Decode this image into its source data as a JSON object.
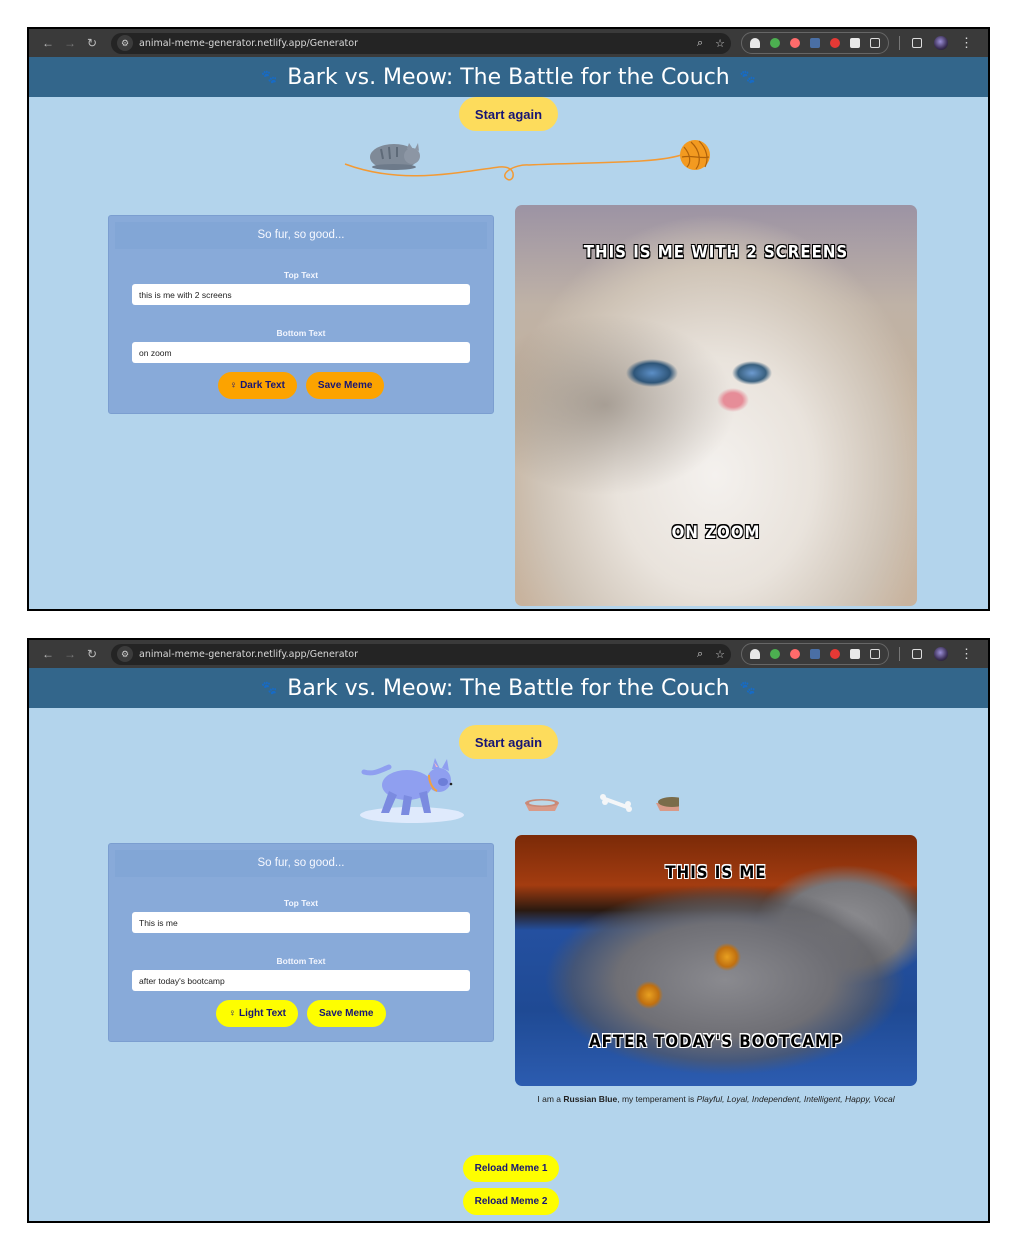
{
  "screens": [
    {
      "browser": {
        "url": "animal-meme-generator.netlify.app/Generator",
        "nav": {
          "back": "←",
          "forward": "→",
          "reload": "↻"
        }
      },
      "header": {
        "title": "Bark vs. Meow: The Battle for the Couch",
        "icon_left": "paw-icon",
        "icon_right": "paw-icon"
      },
      "start_again_label": "Start again",
      "illustration": "sleeping-cat-with-yarn-ball",
      "form": {
        "title": "So fur, so good...",
        "top_label": "Top Text",
        "top_value": "this is me with 2 screens",
        "bottom_label": "Bottom Text",
        "bottom_value": "on zoom",
        "toggle_label": "Dark Text",
        "save_label": "Save Meme",
        "button_color": "#fca300"
      },
      "meme": {
        "top_text": "THIS IS ME WITH 2 SCREENS",
        "bottom_text": "ON ZOOM",
        "text_style": "light",
        "image": "white-fluffy-kitten-looking-up"
      }
    },
    {
      "browser": {
        "url": "animal-meme-generator.netlify.app/Generator",
        "nav": {
          "back": "←",
          "forward": "→",
          "reload": "↻"
        }
      },
      "header": {
        "title": "Bark vs. Meow: The Battle for the Couch",
        "icon_left": "paw-icon",
        "icon_right": "paw-icon"
      },
      "start_again_label": "Start again",
      "illustration": "dog-with-bowls-and-bone",
      "form": {
        "title": "So fur, so good...",
        "top_label": "Top Text",
        "top_value": "This is me",
        "bottom_label": "Bottom Text",
        "bottom_value": "after today's bootcamp",
        "toggle_label": "Light Text",
        "save_label": "Save Meme",
        "button_color": "#fefe00"
      },
      "meme": {
        "top_text": "THIS IS ME",
        "bottom_text": "AFTER TODAY'S BOOTCAMP",
        "text_style": "dark",
        "image": "grey-cat-lying-on-blue-blanket"
      },
      "caption": {
        "prefix": "I am a ",
        "breed": "Russian Blue",
        "middle": ", my temperament is ",
        "temperament": "Playful, Loyal, Independent, Intelligent, Happy, Vocal"
      },
      "reload_buttons": [
        "Reload Meme 1",
        "Reload Meme 2"
      ]
    }
  ],
  "colors": {
    "header_bg": "#33668b",
    "page_bg": "#b3d4ec",
    "panel_bg": "#88aad9",
    "start_button": "#fddc5c",
    "button_text": "#171575"
  },
  "paw_glyph": "🐾",
  "bulb_glyph": "💡"
}
